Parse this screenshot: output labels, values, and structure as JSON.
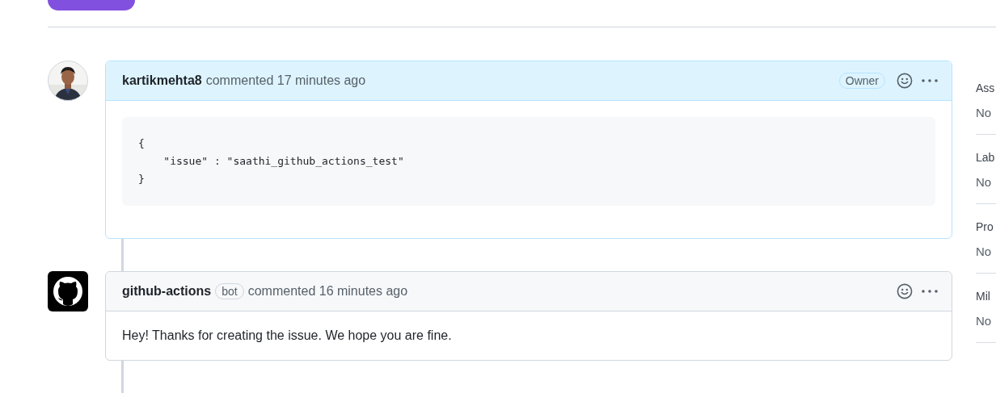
{
  "comments": [
    {
      "author": "kartikmehta8",
      "action": "commented 17 minutes ago",
      "role": "Owner",
      "highlighted": true,
      "body": {
        "kind": "code",
        "lines": [
          "{",
          "    \"issue\" : \"saathi_github_actions_test\"",
          "}"
        ]
      }
    },
    {
      "author": "github-actions",
      "avatar": {
        "kind": "logo"
      },
      "badge": "bot",
      "action": "commented 16 minutes ago",
      "highlighted": false,
      "body": {
        "kind": "text",
        "text": "Hey! Thanks for creating the issue. We hope you are fine."
      }
    }
  ],
  "sidebar": [
    {
      "heading": "Ass",
      "value": "No"
    },
    {
      "heading": "Lab",
      "value": "No"
    },
    {
      "heading": "Pro",
      "value": "No"
    },
    {
      "heading": "Mil",
      "value": "No"
    }
  ]
}
